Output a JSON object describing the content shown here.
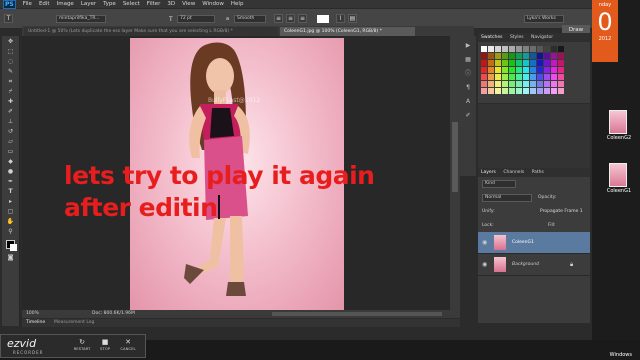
{
  "app": {
    "logo": "PS",
    "workspace_button": "Draw",
    "workspace_field": "Lyka's Works"
  },
  "menu": [
    "File",
    "Edit",
    "Image",
    "Layer",
    "Type",
    "Select",
    "Filter",
    "3D",
    "View",
    "Window",
    "Help"
  ],
  "options": {
    "font_family": "mintaprilfika_TR...",
    "font_size": "72 pt",
    "antialias": "Smooth",
    "aa_prefix": "a",
    "font_size_prefix": "T"
  },
  "tabs": [
    {
      "label": "Untitled-1 @ 50% (Lets duplicate the ess layer Make sure that you are selecting L RGB/8) *",
      "active": false
    },
    {
      "label": "ColeenG1.jpg @ 100% (ColeenG1, RGB/8) *",
      "active": true
    }
  ],
  "canvas": {
    "text_line1": "lets try to play it again",
    "text_line2": "after editin",
    "watermark": "BullyFLast@2012"
  },
  "status": {
    "zoom": "100%",
    "doc": "Doc: 800.6K/1.96M"
  },
  "timeline": {
    "tab1": "Timeline",
    "tab2": "Measurement Log"
  },
  "panels": {
    "swatches_tabs": [
      "Swatches",
      "Styles",
      "Navigator"
    ],
    "layers_tabs": [
      "Layers",
      "Channels",
      "Paths"
    ],
    "kind_label": "Kind",
    "blend_mode": "Normal",
    "opacity_label": "Opacity:",
    "unify_label": "Unify:",
    "propagate_label": "Propagate Frame 1",
    "lock_label": "Lock:",
    "fill_label": "Fill:",
    "layers": [
      {
        "name": "ColeenG1",
        "selected": true
      },
      {
        "name": "Background",
        "selected": false
      }
    ]
  },
  "desktop": {
    "calendar_day": "nday",
    "calendar_date": "0",
    "calendar_year": "2012",
    "icons": [
      "ColeenG2",
      "ColeenG1"
    ],
    "windows_label": "Windows"
  },
  "ezvid": {
    "logo": "ezvid",
    "sub": "RECORDER",
    "buttons": [
      "RESTART",
      "STOP",
      "CANCEL"
    ]
  },
  "colors": {
    "overlay_text": "#e81e1e",
    "calendar": "#e25a1c",
    "layer_selected": "#5a7aa0"
  }
}
